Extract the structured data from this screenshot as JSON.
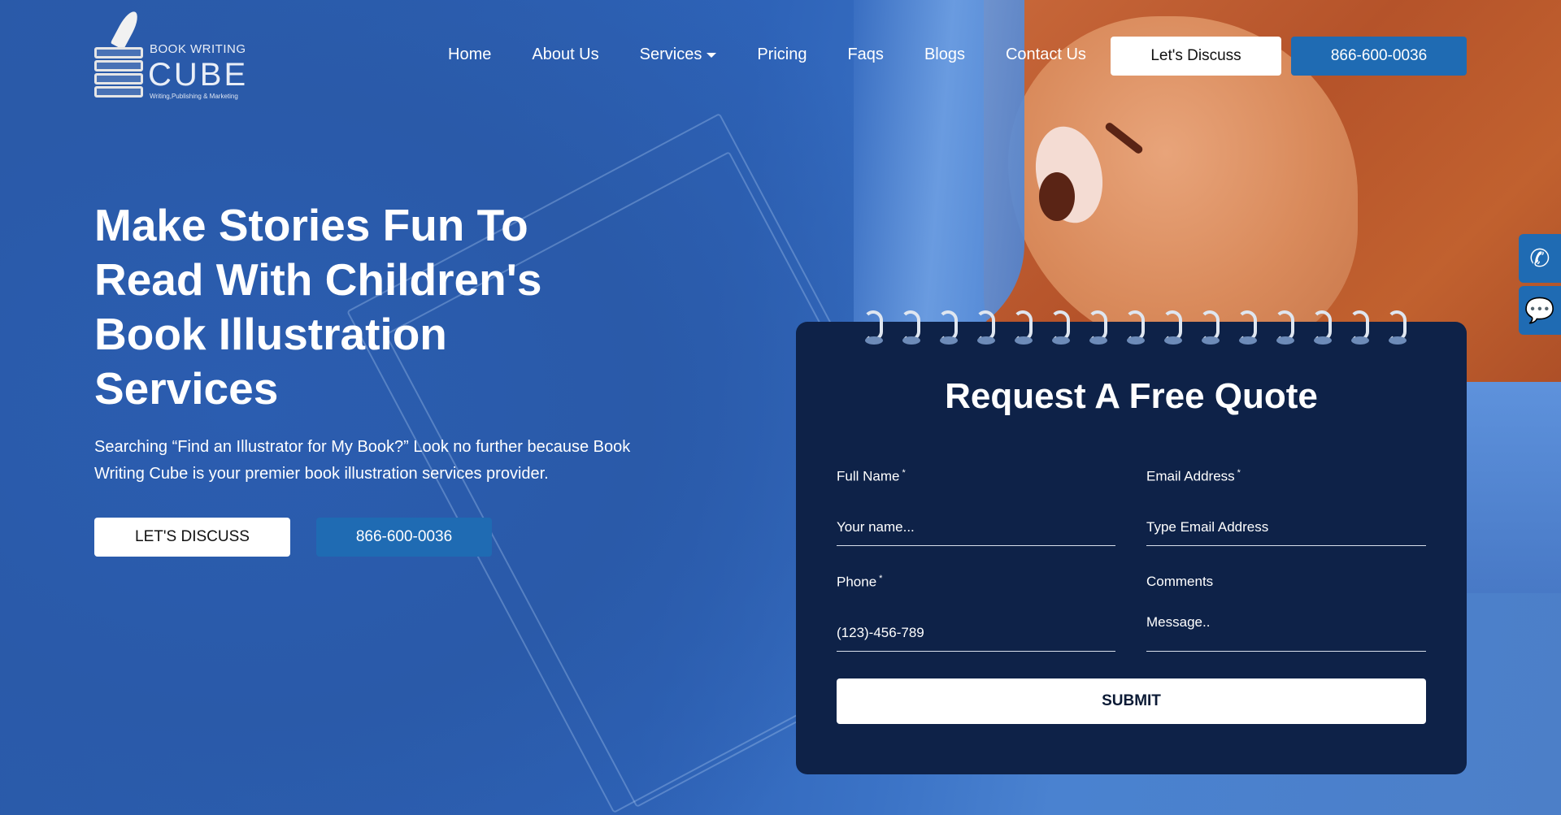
{
  "brand": {
    "top": "BOOK WRITING",
    "main": "CUBE",
    "sub": "Writing,Publishing & Marketing"
  },
  "nav": {
    "items": [
      "Home",
      "About Us",
      "Services",
      "Pricing",
      "Faqs",
      "Blogs",
      "Contact Us"
    ],
    "discuss": "Let's Discuss",
    "phone": "866-600-0036"
  },
  "hero": {
    "title": "Make Stories Fun To Read With Children's Book Illustration Services",
    "text": "Searching “Find an Illustrator for My Book?” Look no further because Book Writing Cube is your premier book illustration services provider.",
    "discuss": "LET'S DISCUSS",
    "phone": "866-600-0036"
  },
  "form": {
    "title": "Request A Free Quote",
    "name_label": "Full Name",
    "name_placeholder": "Your name...",
    "email_label": "Email Address",
    "email_placeholder": "Type Email Address",
    "phone_label": "Phone",
    "phone_placeholder": "(123)-456-789",
    "comments_label": "Comments",
    "comments_placeholder": "Message..",
    "required_mark": "*",
    "submit": "SUBMIT"
  },
  "side": {
    "phone_icon": "phone-icon",
    "chat_icon": "chat-icon"
  },
  "colors": {
    "background": "#2f62b7",
    "card": "#0e2248",
    "accent": "#1f6bb3"
  }
}
